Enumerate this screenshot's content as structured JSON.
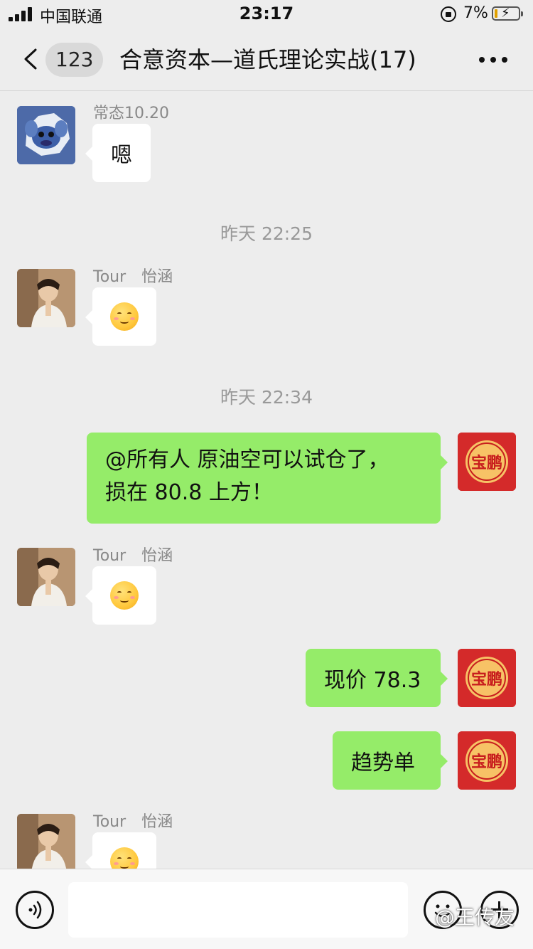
{
  "status_bar": {
    "carrier": "中国联通",
    "time": "23:17",
    "battery_percent": "7%"
  },
  "nav_bar": {
    "unread_count": "123",
    "title": "合意资本—道氏理论实战(17)"
  },
  "messages": [
    {
      "type": "received",
      "sender": "常态10.20",
      "text": "嗯",
      "avatar": "stitch-avatar"
    },
    {
      "type": "time",
      "text": "昨天 22:25"
    },
    {
      "type": "received",
      "sender": "Tour　怡涵",
      "emoji": "smiling-face-emoji",
      "avatar": "tour-avatar"
    },
    {
      "type": "time",
      "text": "昨天 22:34"
    },
    {
      "type": "sent",
      "lines": [
        "@所有人 原油空可以试仓了，",
        "损在 80.8 上方！"
      ],
      "avatar": "self-avatar"
    },
    {
      "type": "received",
      "sender": "Tour　怡涵",
      "emoji": "smiling-face-emoji",
      "avatar": "tour-avatar"
    },
    {
      "type": "sent",
      "text": "现价 78.3",
      "avatar": "self-avatar"
    },
    {
      "type": "sent",
      "text": "趋势单",
      "avatar": "self-avatar"
    },
    {
      "type": "received",
      "sender": "Tour　怡涵",
      "emoji": "smiling-face-emoji",
      "avatar": "tour-avatar"
    }
  ],
  "avatar_self_glyph": "宝鹏",
  "watermark": "@王传友",
  "colors": {
    "background": "#ededed",
    "sent_bubble": "#95ec69",
    "received_bubble": "#ffffff",
    "self_avatar": "#d42a2a"
  }
}
